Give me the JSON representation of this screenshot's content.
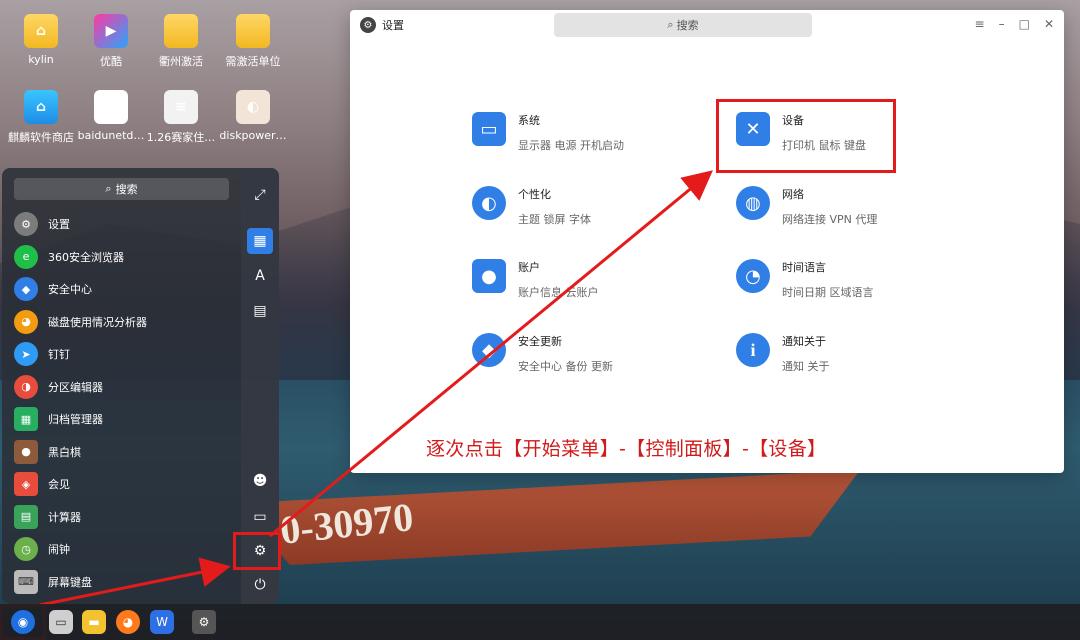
{
  "desktop": {
    "icons": [
      {
        "label": "kylin",
        "icon": "home-folder-icon"
      },
      {
        "label": "优酷",
        "icon": "youku-icon"
      },
      {
        "label": "衢州激活",
        "icon": "folder-icon"
      },
      {
        "label": "需激活单位",
        "icon": "folder-icon"
      },
      {
        "label": "麒麟软件商店",
        "icon": "store-icon"
      },
      {
        "label": "baidunetd…",
        "icon": "baidu-netdisk-icon"
      },
      {
        "label": "1.26赛家住…",
        "icon": "document-icon"
      },
      {
        "label": "diskpower…",
        "icon": "diskpower-icon"
      }
    ],
    "wallpaper_text": "0-30970"
  },
  "start_menu": {
    "search_placeholder": "搜索",
    "items": [
      {
        "label": "设置",
        "icon": "settings-icon",
        "color": "#7c7c7c"
      },
      {
        "label": "360安全浏览器",
        "icon": "360-browser-icon",
        "color": "#1fbf4a"
      },
      {
        "label": "安全中心",
        "icon": "security-center-icon",
        "color": "#2f7fe6"
      },
      {
        "label": "磁盘使用情况分析器",
        "icon": "disk-analyzer-icon",
        "color": "#f39c12"
      },
      {
        "label": "钉钉",
        "icon": "dingtalk-icon",
        "color": "#2f9bf4"
      },
      {
        "label": "分区编辑器",
        "icon": "partition-editor-icon",
        "color": "#e74c3c"
      },
      {
        "label": "归档管理器",
        "icon": "archive-manager-icon",
        "color": "#27ae60"
      },
      {
        "label": "黑白棋",
        "icon": "reversi-icon",
        "color": "#8e5a3c"
      },
      {
        "label": "会见",
        "icon": "meeting-icon",
        "color": "#e74c3c"
      },
      {
        "label": "计算器",
        "icon": "calculator-icon",
        "color": "#3aa35a"
      },
      {
        "label": "闹钟",
        "icon": "alarm-clock-icon",
        "color": "#6ab04c"
      },
      {
        "label": "屏幕键盘",
        "icon": "keyboard-icon",
        "color": "#bbbbbb"
      }
    ]
  },
  "settings_window": {
    "title": "设置",
    "search_placeholder": "搜索",
    "categories": [
      {
        "name": "系统",
        "items": "显示器  电源  开机启动",
        "icon": "monitor-icon",
        "glyph": "▭"
      },
      {
        "name": "设备",
        "items": "打印机  鼠标  键盘",
        "icon": "tools-icon",
        "glyph": "✕"
      },
      {
        "name": "个性化",
        "items": "主题  锁屏  字体",
        "icon": "palette-icon",
        "glyph": "◐"
      },
      {
        "name": "网络",
        "items": "网络连接  VPN  代理",
        "icon": "globe-icon",
        "glyph": "◍"
      },
      {
        "name": "账户",
        "items": "账户信息  云账户",
        "icon": "user-icon",
        "glyph": "●"
      },
      {
        "name": "时间语言",
        "items": "时间日期  区域语言",
        "icon": "clock-icon",
        "glyph": "◔"
      },
      {
        "name": "安全更新",
        "items": "安全中心  备份  更新",
        "icon": "shield-update-icon",
        "glyph": "◆"
      },
      {
        "name": "通知关于",
        "items": "通知  关于",
        "icon": "info-icon",
        "glyph": "i"
      }
    ],
    "instruction": "逐次点击【开始菜单】-【控制面板】-【设备】"
  },
  "colors": {
    "accent": "#2f7fe6",
    "annotation_red": "#e31b1b"
  }
}
